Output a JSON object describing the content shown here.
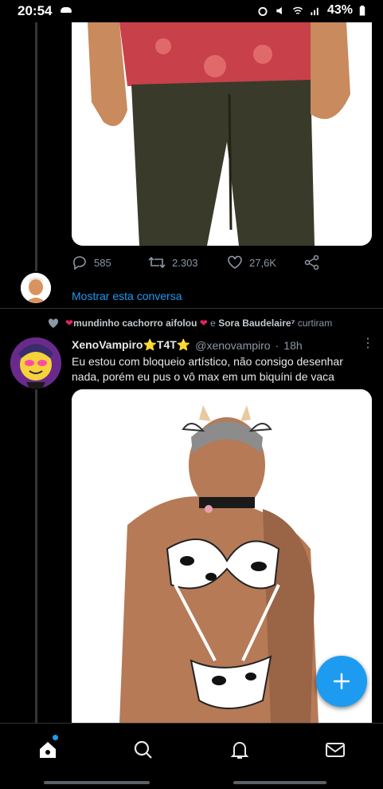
{
  "status_bar": {
    "time": "20:54",
    "battery": "43%"
  },
  "prev_tweet": {
    "replies": "585",
    "retweets": "2.303",
    "likes": "27,6K",
    "show_conversation": "Mostrar esta conversa"
  },
  "social_context": {
    "liker1": "mundinho cachorro aifolou",
    "joiner": "e",
    "liker2": "Sora Baudelaire⁷",
    "suffix": "curtiram"
  },
  "tweet": {
    "name": "XenoVampiro⭐T4T⭐",
    "handle": "@xenovampiro",
    "separator": "·",
    "time": "18h",
    "text": "Eu estou com bloqueio artístico, não consigo desenhar nada, porém eu pus o vô max em um biquíni de vaca"
  },
  "icons": {
    "reply": "reply-icon",
    "retweet": "retweet-icon",
    "like": "like-icon",
    "share": "share-icon",
    "compose": "compose-icon",
    "home": "home-icon",
    "search": "search-icon",
    "notifications": "bell-icon",
    "messages": "mail-icon"
  },
  "colors": {
    "accent": "#1d9bf0",
    "background": "#000000",
    "secondary_text": "#8b98a5"
  }
}
